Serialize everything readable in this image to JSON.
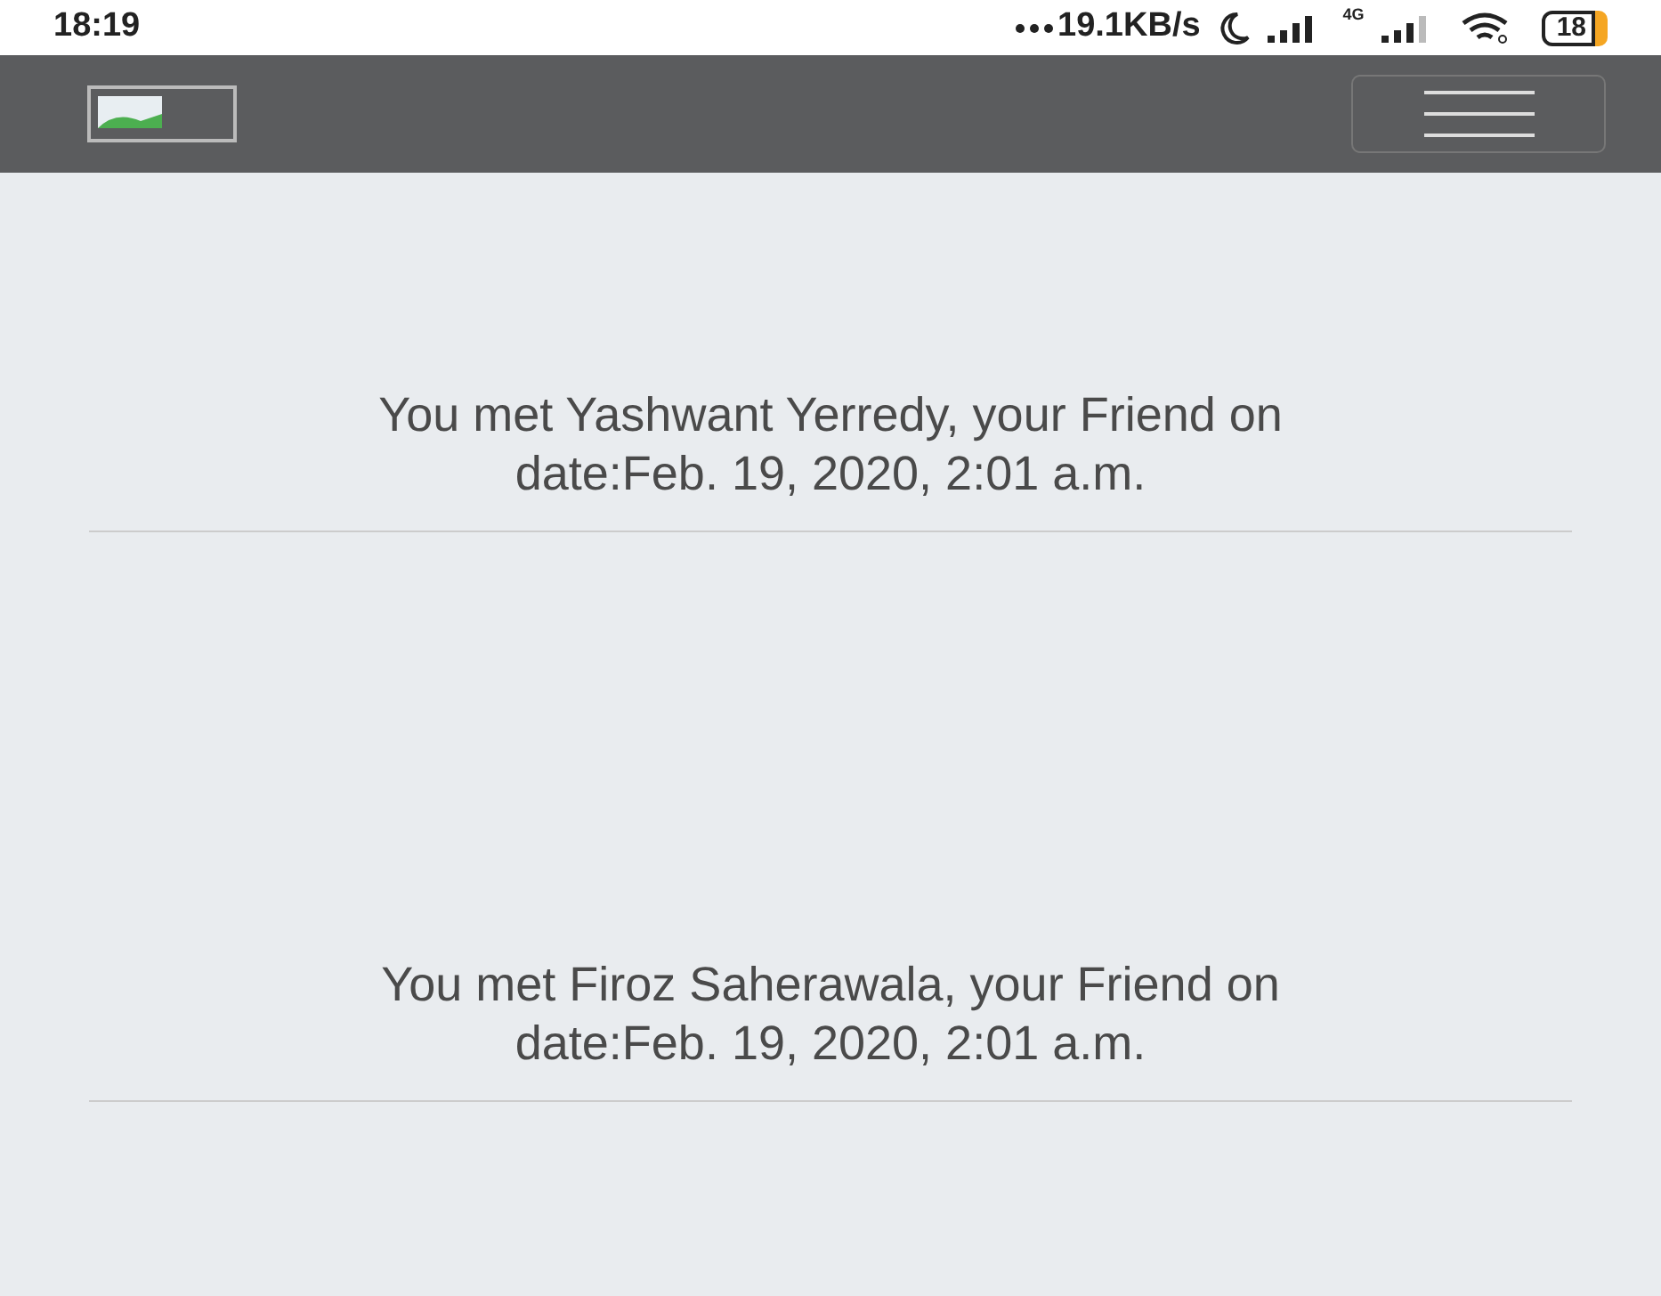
{
  "status_bar": {
    "time": "18:19",
    "speed": "19.1KB/s",
    "network": "4G",
    "battery": "18"
  },
  "meetings": [
    {
      "message": "You met Yashwant Yerredy, your Friend on",
      "date": "date:Feb. 19, 2020, 2:01 a.m."
    },
    {
      "message": "You met Firoz Saherawala, your Friend on",
      "date": "date:Feb. 19, 2020, 2:01 a.m."
    }
  ]
}
